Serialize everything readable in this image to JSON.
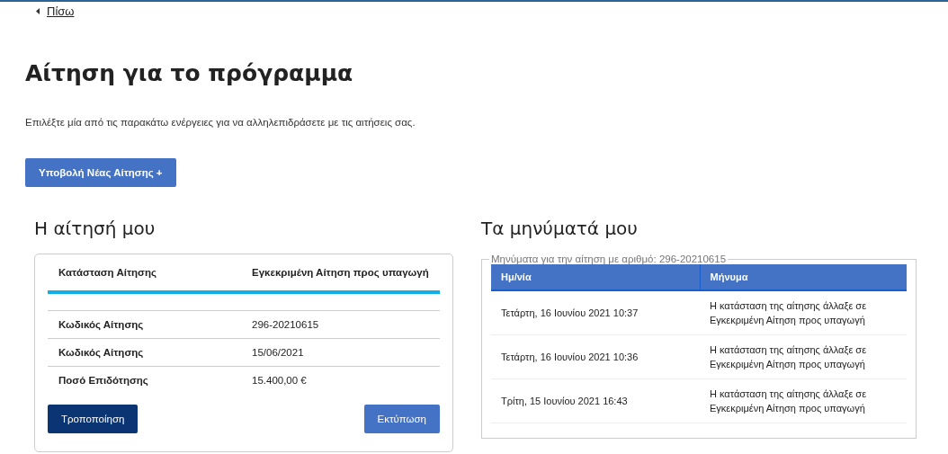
{
  "back_link": "Πίσω",
  "title": "Αίτηση για το πρόγραμμα",
  "intro": "Επιλέξτε μία από τις παρακάτω ενέργειες για να αλληλεπιδράσετε με τις αιτήσεις σας.",
  "new_button": "Υποβολή Νέας Αίτησης +",
  "my_application": {
    "heading": "Η αίτησή μου",
    "status": {
      "label": "Κατάσταση Αίτησης",
      "value": "Εγκεκριμένη Αίτηση προς υπαγωγή"
    },
    "rows": [
      {
        "label": "Κωδικός Αίτησης",
        "value": "296-20210615"
      },
      {
        "label": "Κωδικός Αίτησης",
        "value": "15/06/2021"
      },
      {
        "label": "Ποσό Επιδότησης",
        "value": "15.400,00 €"
      }
    ],
    "buttons": [
      {
        "label": "Τροποποίηση",
        "kind": "primary"
      },
      {
        "label": "Εκτύπωση",
        "kind": "secondary"
      }
    ]
  },
  "messages": {
    "heading": "Τα μηνύματά μου",
    "legend": "Μηνύματα για την αίτηση με αριθμό: 296-20210615",
    "columns": [
      "Ημ/νία",
      "Μήνυμα"
    ],
    "rows": [
      {
        "date": "Τετάρτη, 16 Ιουνίου 2021 10:37",
        "message": "Η κατάσταση της αίτησης άλλαξε σε Εγκεκριμένη Αίτηση προς υπαγωγή"
      },
      {
        "date": "Τετάρτη, 16 Ιουνίου 2021 10:36",
        "message": "Η κατάσταση της αίτησης άλλαξε σε Εγκεκριμένη Αίτηση προς υπαγωγή"
      },
      {
        "date": "Τρίτη, 15 Ιουνίου 2021 16:43",
        "message": "Η κατάσταση της αίτησης άλλαξε σε Εγκεκριμένη Αίτηση προς υπαγωγή"
      }
    ]
  }
}
